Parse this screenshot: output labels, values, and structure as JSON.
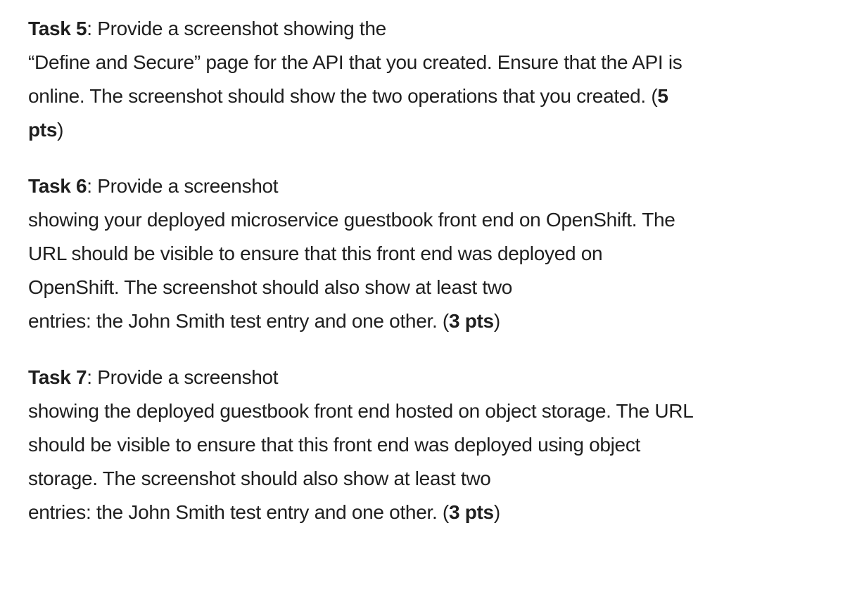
{
  "tasks": [
    {
      "lines": [
        [
          {
            "text": "Task 5",
            "bold": true
          },
          {
            "text": ": Provide a screenshot showing the",
            "bold": false
          }
        ],
        [
          {
            "text": "“Define and Secure” page for the API that you created. Ensure that the API is",
            "bold": false
          }
        ],
        [
          {
            "text": "online. The screenshot should show the two operations that you created. (",
            "bold": false
          },
          {
            "text": "5",
            "bold": true
          }
        ],
        [
          {
            "text": "pts",
            "bold": true
          },
          {
            "text": ")",
            "bold": false
          }
        ]
      ]
    },
    {
      "lines": [
        [
          {
            "text": "Task 6",
            "bold": true
          },
          {
            "text": ": Provide a screenshot",
            "bold": false
          }
        ],
        [
          {
            "text": "showing your deployed microservice guestbook front end on OpenShift. The",
            "bold": false
          }
        ],
        [
          {
            "text": "URL should be visible to ensure that this front end was deployed on",
            "bold": false
          }
        ],
        [
          {
            "text": "OpenShift. The screenshot should also show at least two",
            "bold": false
          }
        ],
        [
          {
            "text": "entries: the John Smith test entry and one other. (",
            "bold": false
          },
          {
            "text": "3 pts",
            "bold": true
          },
          {
            "text": ")",
            "bold": false
          }
        ]
      ]
    },
    {
      "lines": [
        [
          {
            "text": "Task 7",
            "bold": true
          },
          {
            "text": ": Provide a screenshot",
            "bold": false
          }
        ],
        [
          {
            "text": "showing the deployed guestbook front end hosted on object storage. The URL",
            "bold": false
          }
        ],
        [
          {
            "text": "should be visible to ensure that this front end was deployed using object",
            "bold": false
          }
        ],
        [
          {
            "text": "storage. The screenshot should also show at least two",
            "bold": false
          }
        ],
        [
          {
            "text": "entries: the John Smith test entry and one other. (",
            "bold": false
          },
          {
            "text": "3 pts",
            "bold": true
          },
          {
            "text": ")",
            "bold": false
          }
        ]
      ]
    }
  ]
}
